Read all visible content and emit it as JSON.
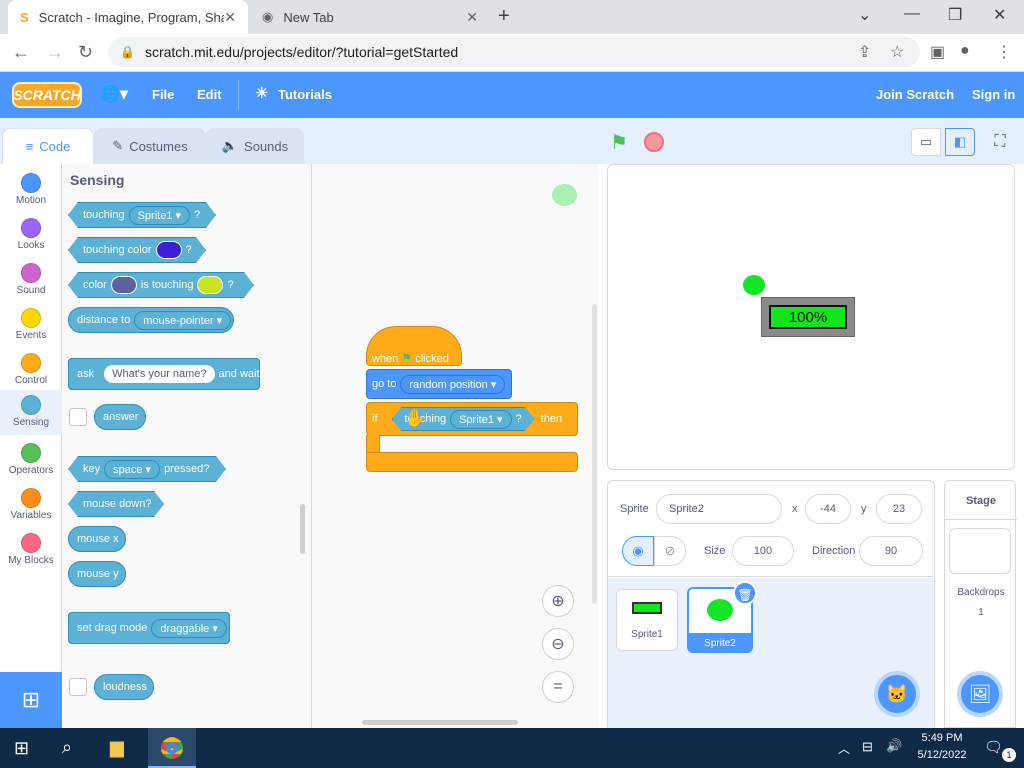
{
  "browser": {
    "tab1_title": "Scratch - Imagine, Program, Shar",
    "tab2_title": "New Tab",
    "url": "scratch.mit.edu/projects/editor/?tutorial=getStarted"
  },
  "menu": {
    "logo": "SCRATCH",
    "file": "File",
    "edit": "Edit",
    "tutorials": "Tutorials",
    "join": "Join Scratch",
    "signin": "Sign in"
  },
  "tabs": {
    "code": "Code",
    "costumes": "Costumes",
    "sounds": "Sounds"
  },
  "categories": [
    "Motion",
    "Looks",
    "Sound",
    "Events",
    "Control",
    "Sensing",
    "Operators",
    "Variables",
    "My Blocks"
  ],
  "category_colors": [
    "#4c97ff",
    "#9966ff",
    "#cf63cf",
    "#ffd500",
    "#ffab19",
    "#5cb1d6",
    "#59c059",
    "#ff8c1a",
    "#ff6680"
  ],
  "palette": {
    "heading": "Sensing",
    "touching": "touching",
    "touching_val": "Sprite1",
    "q": "?",
    "touching_color": "touching color",
    "color": "color",
    "is_touching": "is touching",
    "distance_to": "distance to",
    "distance_val": "mouse-pointer",
    "ask": "ask",
    "ask_val": "What's your name?",
    "and_wait": "and wait",
    "answer": "answer",
    "key": "key",
    "key_val": "space",
    "pressed": "pressed?",
    "mouse_down": "mouse down?",
    "mouse_x": "mouse x",
    "mouse_y": "mouse y",
    "set_drag": "set drag mode",
    "drag_val": "draggable",
    "loudness": "loudness"
  },
  "script": {
    "when": "when",
    "clicked": "clicked",
    "goto": "go to",
    "goto_val": "random position",
    "if": "if",
    "touching": "touching",
    "touching_val": "Sprite1",
    "q": "?",
    "then": "then"
  },
  "stage": {
    "progress_label": "100%"
  },
  "sprite_info": {
    "sprite_label": "Sprite",
    "sprite_name": "Sprite2",
    "x_label": "x",
    "x": "-44",
    "y_label": "y",
    "y": "23",
    "size_label": "Size",
    "size": "100",
    "direction_label": "Direction",
    "direction": "90"
  },
  "sprites": [
    {
      "name": "Sprite1"
    },
    {
      "name": "Sprite2"
    }
  ],
  "stage_pane": {
    "title": "Stage",
    "backdrops_label": "Backdrops",
    "backdrops_count": "1"
  },
  "taskbar": {
    "time": "5:49 PM",
    "date": "5/12/2022",
    "notifications": "1"
  }
}
